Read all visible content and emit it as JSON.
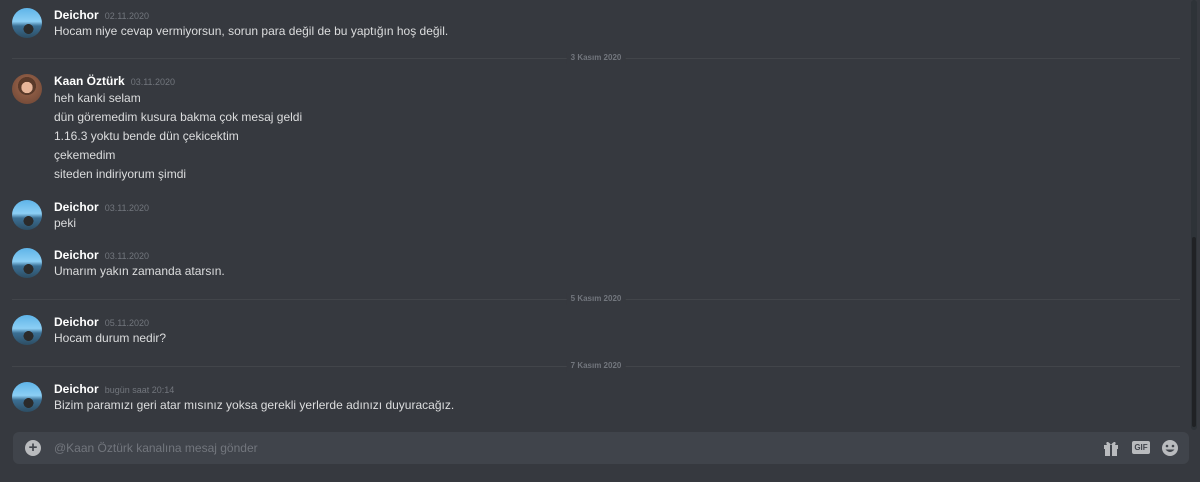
{
  "messages": [
    {
      "author": "Deichor",
      "timestamp": "02.11.2020",
      "lines": [
        "Hocam niye cevap vermiyorsun, sorun para değil de bu yaptığın hoş değil."
      ]
    },
    {
      "author": "Kaan Öztürk",
      "timestamp": "03.11.2020",
      "lines": [
        "heh kanki selam",
        "dün göremedim kusura bakma çok mesaj geldi",
        "1.16.3 yoktu bende dün çekicektim",
        "çekemedim",
        "siteden indiriyorum şimdi"
      ]
    },
    {
      "author": "Deichor",
      "timestamp": "03.11.2020",
      "lines": [
        "peki"
      ]
    },
    {
      "author": "Deichor",
      "timestamp": "03.11.2020",
      "lines": [
        "Umarım yakın zamanda atarsın."
      ]
    },
    {
      "author": "Deichor",
      "timestamp": "05.11.2020",
      "lines": [
        "Hocam durum nedir?"
      ]
    },
    {
      "author": "Deichor",
      "timestamp": "bugün saat 20:14",
      "lines": [
        "Bizim paramızı geri atar mısınız yoksa gerekli yerlerde adınızı duyuracağız."
      ]
    }
  ],
  "dividers": [
    "3 Kasım 2020",
    "5 Kasım 2020",
    "7 Kasım 2020"
  ],
  "composer": {
    "placeholder": "@Kaan Öztürk kanalına mesaj gönder",
    "add_icon": "plus-circle-icon",
    "gift_icon": "gift-icon",
    "gif_label": "GIF",
    "emoji_icon": "emoji-icon"
  }
}
